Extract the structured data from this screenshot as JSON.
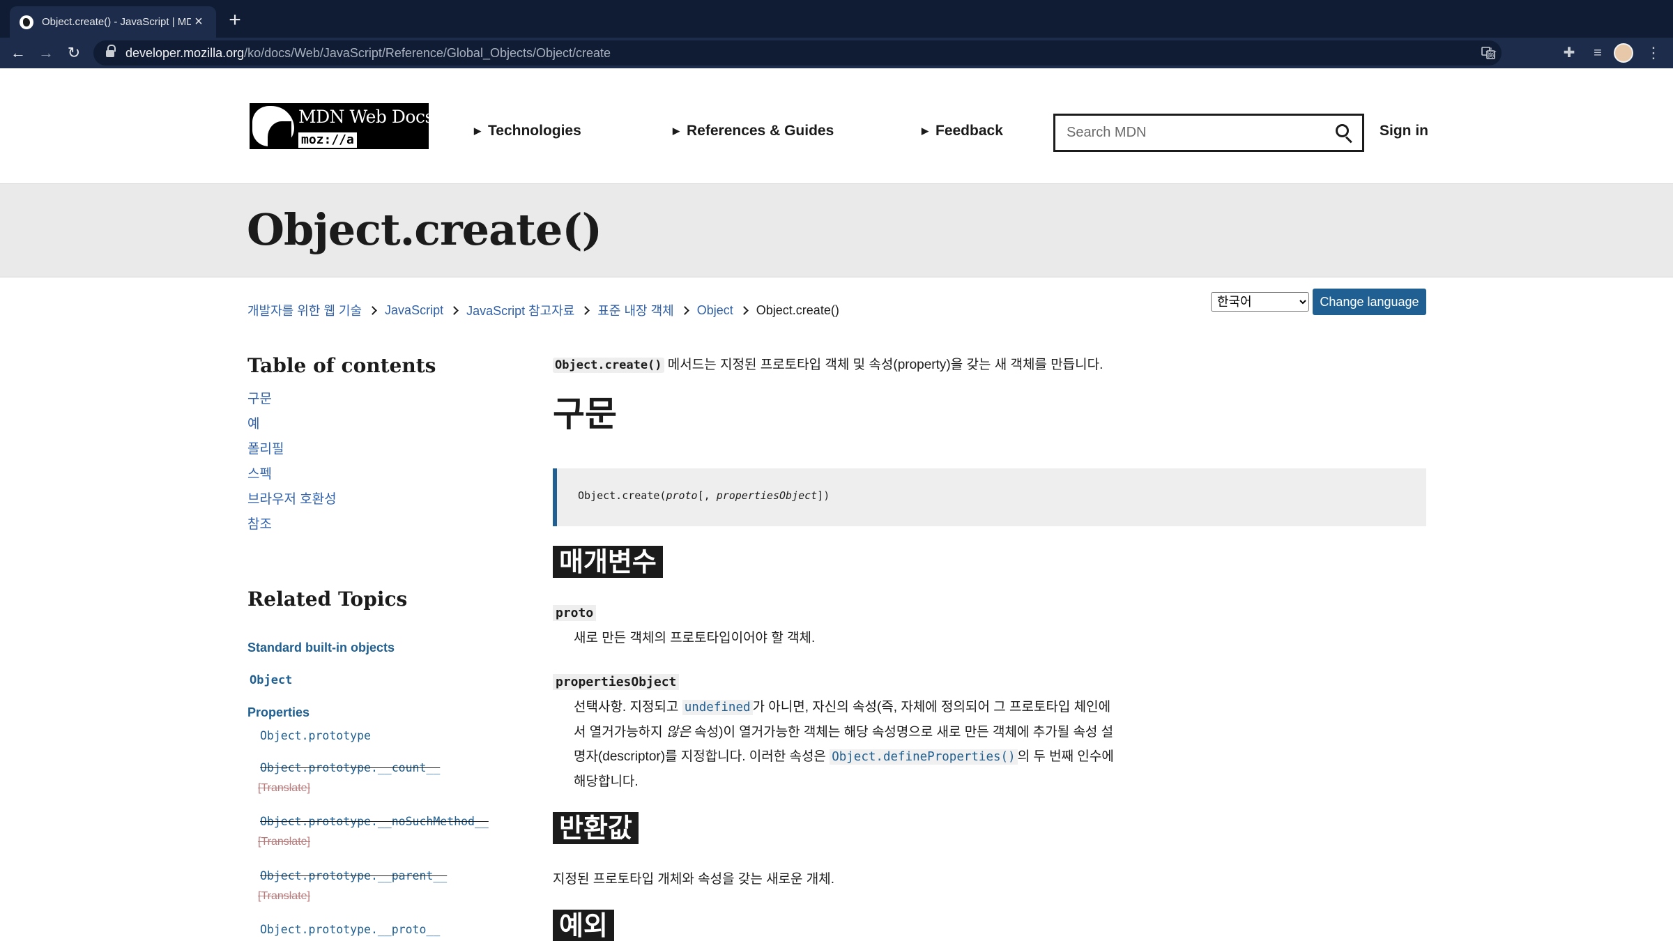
{
  "browser": {
    "tab_title": "Object.create() - JavaScript | MDN",
    "tab_close": "×",
    "new_tab": "+",
    "url_host": "developer.mozilla.org",
    "url_path": "/ko/docs/Web/JavaScript/Reference/Global_Objects/Object/create",
    "icons": {
      "back": "←",
      "forward": "→",
      "reload": "↻",
      "translate": "G",
      "star": "☆",
      "extensions": "✚",
      "media": "≡",
      "menu": "⋮"
    }
  },
  "header": {
    "logo_text": "MDN Web Docs",
    "logo_moz": "moz://a",
    "nav": {
      "technologies": "Technologies",
      "references": "References & Guides",
      "feedback": "Feedback"
    },
    "nav_marker": "▶",
    "search_placeholder": "Search MDN",
    "sign_in": "Sign in"
  },
  "page": {
    "title": "Object.create()"
  },
  "breadcrumb": {
    "items": [
      "개발자를 위한 웹 기술",
      "JavaScript",
      "JavaScript 참고자료",
      "표준 내장 객체",
      "Object"
    ],
    "current": "Object.create()"
  },
  "language": {
    "selected": "한국어",
    "button": "Change language"
  },
  "sidebar": {
    "toc_heading": "Table of contents",
    "toc": [
      "구문",
      "예",
      "폴리필",
      "스펙",
      "브라우저 호환성",
      "참조"
    ],
    "related_heading": "Related Topics",
    "standard_builtins": "Standard built-in objects",
    "object": "Object",
    "properties_label": "Properties",
    "properties": [
      {
        "name": "Object.prototype",
        "deprecated": false,
        "translate": ""
      },
      {
        "name": "Object.prototype.__count__",
        "deprecated": true,
        "translate": "[Translate]"
      },
      {
        "name": "Object.prototype.__noSuchMethod__",
        "deprecated": true,
        "translate": "[Translate]"
      },
      {
        "name": "Object.prototype.__parent__",
        "deprecated": true,
        "translate": "[Translate]"
      },
      {
        "name": "Object.prototype.__proto__",
        "deprecated": false,
        "translate": ""
      }
    ]
  },
  "article": {
    "intro_code": "Object.create()",
    "intro_text": " 메서드는 지정된 프로토타입 객체 및 속성(property)을 갖는 새 객체를 만듭니다.",
    "syntax_heading": "구문",
    "syntax": {
      "prefix": "Object.create(",
      "arg1": "proto",
      "mid": "[, ",
      "arg2": "propertiesObject",
      "suffix": "])"
    },
    "params_heading": "매개변수",
    "param_proto": "proto",
    "param_proto_desc": "새로 만든 객체의 프로토타입이어야 할 객체.",
    "param_props": "propertiesObject",
    "param_props_desc": {
      "part1": "선택사항. 지정되고 ",
      "code1": "undefined",
      "part2": "가 아니면, 자신의 속성(즉, 자체에 정의되어 그 프로토타입 체인에서 열거가능하지 ",
      "emph": "않은",
      "part3": " 속성)이 열거가능한 객체는 해당 속성명으로 새로 만든 객체에 추가될 속성 설명자(descriptor)를 지정합니다. 이러한 속성은 ",
      "code2": "Object.defineProperties()",
      "part4": "의 두 번째 인수에 해당합니다."
    },
    "return_heading": "반환값",
    "return_text": "지정된 프로토타입 개체와 속성을 갖는 새로운 개체.",
    "exceptions_heading": "예외"
  }
}
